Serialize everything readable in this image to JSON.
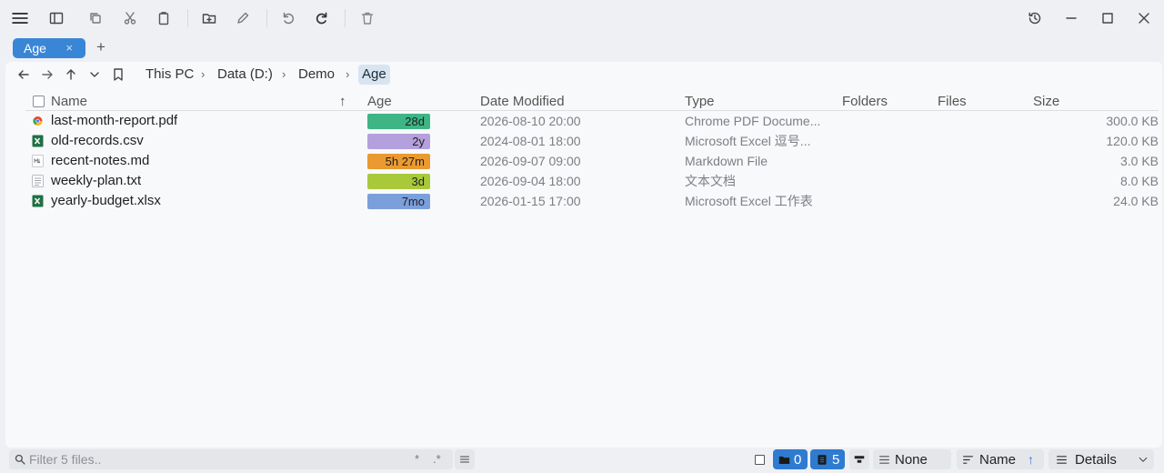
{
  "window": {
    "controls": [
      "history-icon",
      "minimize-icon",
      "maximize-icon",
      "close-icon"
    ]
  },
  "toolbar": {
    "icons": [
      "menu-icon",
      "sidebar-icon",
      "copy-icon",
      "cut-icon",
      "paste-icon",
      "new-folder-icon",
      "rename-icon",
      "undo-icon",
      "redo-icon",
      "delete-icon"
    ]
  },
  "tabs": [
    {
      "label": "Age",
      "close": "×"
    }
  ],
  "tab_add": "+",
  "breadcrumb": {
    "items": [
      "This PC",
      "Data (D:)",
      "Demo",
      "Age"
    ],
    "separator": "›"
  },
  "columns": {
    "name": "Name",
    "age": "Age",
    "date": "Date Modified",
    "type": "Type",
    "folders": "Folders",
    "files": "Files",
    "size": "Size",
    "sort_indicator": "↑"
  },
  "files": [
    {
      "name": "last-month-report.pdf",
      "age": "28d",
      "age_color": "#3db585",
      "date": "2026-08-10 20:00",
      "type": "Chrome PDF Docume...",
      "size": "300.0 KB",
      "icon": "pdf-icon"
    },
    {
      "name": "old-records.csv",
      "age": "2y",
      "age_color": "#b4a0dc",
      "date": "2024-08-01 18:00",
      "type": "Microsoft Excel 逗号...",
      "size": "120.0 KB",
      "icon": "excel-icon"
    },
    {
      "name": "recent-notes.md",
      "age": "5h 27m",
      "age_color": "#ea9a30",
      "date": "2026-09-07 09:00",
      "type": "Markdown File",
      "size": "3.0 KB",
      "icon": "markdown-icon"
    },
    {
      "name": "weekly-plan.txt",
      "age": "3d",
      "age_color": "#a9c93b",
      "date": "2026-09-04 18:00",
      "type": "文本文档",
      "size": "8.0 KB",
      "icon": "text-file-icon"
    },
    {
      "name": "yearly-budget.xlsx",
      "age": "7mo",
      "age_color": "#7b9fdb",
      "date": "2026-01-15 17:00",
      "type": "Microsoft Excel 工作表",
      "size": "24.0 KB",
      "icon": "excel-icon"
    }
  ],
  "statusbar": {
    "filter_placeholder": "Filter 5 files..",
    "filter_modes": [
      "*",
      ".*"
    ],
    "folder_count": "0",
    "file_count": "5",
    "group_by": "None",
    "sort_by": "Name",
    "sort_dir": "↑",
    "view_mode": "Details"
  }
}
